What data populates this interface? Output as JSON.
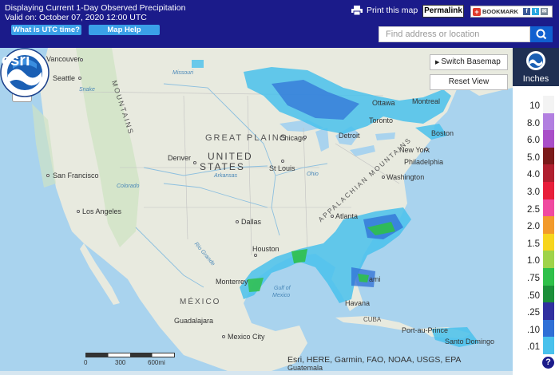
{
  "header": {
    "title_line1": "Displaying Current 1-Day Observed Precipitation",
    "title_line2": "Valid on: October 07, 2020 12:00 UTC",
    "utc_button": "What is UTC time?",
    "help_button": "Map Help",
    "print_label": "Print this map",
    "permalink_label": "Permalink",
    "bookmark_label": "BOOKMARK",
    "search_placeholder": "Find address or location"
  },
  "map": {
    "switch_basemap": "Switch Basemap",
    "reset_view": "Reset View",
    "zoom_in": "+",
    "zoom_out": "−",
    "attribution": "Esri, HERE, Garmin, FAO, NOAA, USGS, EPA",
    "scale_labels": [
      "0",
      "300",
      "600mi"
    ],
    "labels": {
      "vancouver": "Vancouver",
      "seattle": "Seattle",
      "san_francisco": "San Francisco",
      "los_angeles": "Los Angeles",
      "denver": "Denver",
      "great_plains": "GREAT PLAINS",
      "united": "UNITED",
      "states": "STATES",
      "st_louis": "St Louis",
      "chicago": "Chicago",
      "detroit": "Detroit",
      "toronto": "Toronto",
      "ottawa": "Ottawa",
      "montreal": "Montreal",
      "boston": "Boston",
      "new_york": "New York",
      "philadelphia": "Philadelphia",
      "washington": "Washington",
      "atlanta": "Atlanta",
      "dallas": "Dallas",
      "houston": "Houston",
      "monterrey": "Monterrey",
      "mexico": "MÉXICO",
      "guadalajara": "Guadalajara",
      "mexico_city": "Mexico City",
      "havana": "Havana",
      "cuba": "CUBA",
      "miami": "ami",
      "port_au_prince": "Port-au-Prince",
      "santo_domingo": "Santo Domingo",
      "guatemala": "Guatemala",
      "missouri": "Missouri",
      "arkansas": "Arkansas",
      "colorado": "Colorado",
      "ohio": "Ohio",
      "rio_grande": "Rio Grande",
      "snake": "Snake",
      "gulf": "Gulf of",
      "gulf2": "Mexico",
      "mountains": "MOUNTAINS",
      "appalachian": "APPALACHIAN MOUNTAINS"
    }
  },
  "legend": {
    "unit": "Inches",
    "values": [
      "10",
      "8.0",
      "6.0",
      "5.0",
      "4.0",
      "3.0",
      "2.5",
      "2.0",
      "1.5",
      "1.0",
      ".75",
      ".50",
      ".25",
      ".10",
      ".01"
    ],
    "colors": [
      "#f3f3f3",
      "#b27fe0",
      "#a94ec8",
      "#7a1a1a",
      "#b01f2f",
      "#e81e3a",
      "#f04aa0",
      "#f29a2b",
      "#f7d51d",
      "#9fd34a",
      "#2fc04a",
      "#1c8f3a",
      "#3030a0",
      "#2f6fd6",
      "#49c1ec"
    ]
  }
}
